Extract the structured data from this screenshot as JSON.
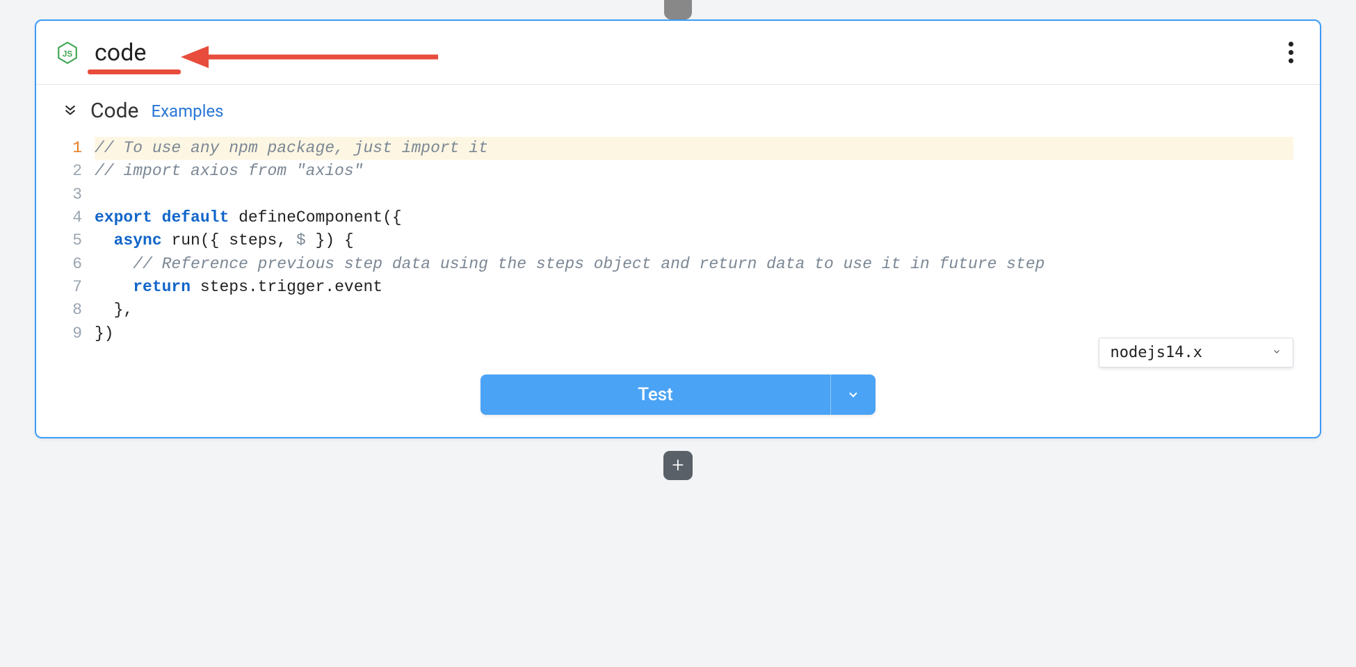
{
  "step": {
    "name": "code",
    "icon": "nodejs"
  },
  "section": {
    "title": "Code",
    "examples_link": "Examples"
  },
  "code": {
    "lines": [
      {
        "n": 1,
        "text": "// To use any npm package, just import it",
        "tokens": [
          [
            "comment",
            "// To use any npm package, just import it"
          ]
        ],
        "highlighted": true,
        "active": true
      },
      {
        "n": 2,
        "text": "// import axios from \"axios\"",
        "tokens": [
          [
            "comment",
            "// import axios from \"axios\""
          ]
        ]
      },
      {
        "n": 3,
        "text": "",
        "tokens": []
      },
      {
        "n": 4,
        "text": "export default defineComponent({",
        "tokens": [
          [
            "keyword",
            "export"
          ],
          [
            "punct",
            " "
          ],
          [
            "keyword",
            "default"
          ],
          [
            "punct",
            " "
          ],
          [
            "ident",
            "defineComponent"
          ],
          [
            "punct",
            "({"
          ]
        ]
      },
      {
        "n": 5,
        "text": "  async run({ steps, $ }) {",
        "tokens": [
          [
            "punct",
            "  "
          ],
          [
            "keyword",
            "async"
          ],
          [
            "punct",
            " "
          ],
          [
            "ident",
            "run"
          ],
          [
            "punct",
            "({ "
          ],
          [
            "param",
            "steps"
          ],
          [
            "punct",
            ", "
          ],
          [
            "var",
            "$"
          ],
          [
            "punct",
            " }) {"
          ]
        ]
      },
      {
        "n": 6,
        "text": "    // Reference previous step data using the steps object and return data to use it in future steps",
        "tokens": [
          [
            "punct",
            "    "
          ],
          [
            "comment",
            "// Reference previous step data using the steps object and return data to use it in future step"
          ]
        ]
      },
      {
        "n": 7,
        "text": "    return steps.trigger.event",
        "tokens": [
          [
            "punct",
            "    "
          ],
          [
            "keyword",
            "return"
          ],
          [
            "punct",
            " "
          ],
          [
            "ident",
            "steps.trigger.event"
          ]
        ]
      },
      {
        "n": 8,
        "text": "  },",
        "tokens": [
          [
            "punct",
            "  },"
          ]
        ]
      },
      {
        "n": 9,
        "text": "})",
        "tokens": [
          [
            "punct",
            "})"
          ]
        ]
      }
    ]
  },
  "runtime": {
    "selected": "nodejs14.x"
  },
  "actions": {
    "test": "Test"
  },
  "annotations": {
    "underline": true,
    "arrow": true
  }
}
